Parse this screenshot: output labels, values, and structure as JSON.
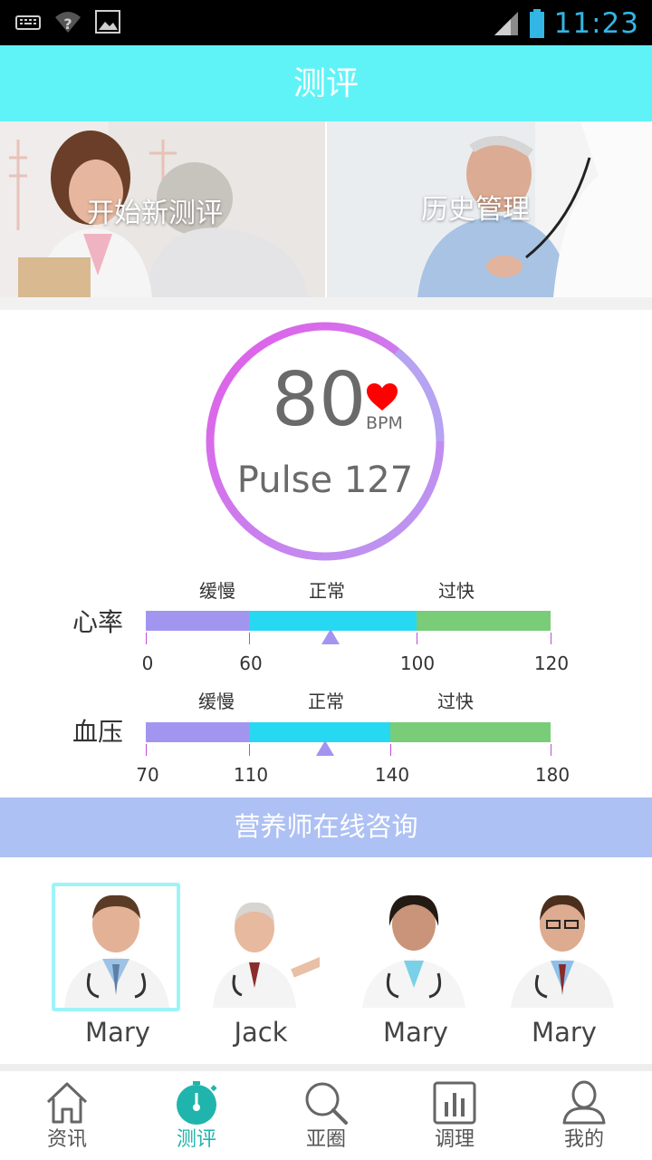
{
  "status_bar": {
    "time": "11:23",
    "icons": [
      "keyboard-icon",
      "wifi-unknown-icon",
      "image-icon",
      "signal-icon",
      "battery-icon"
    ],
    "time_color": "#33b5e5"
  },
  "header": {
    "title": "测评",
    "background": "#5ff3f7"
  },
  "banners": [
    {
      "label": "开始新测评"
    },
    {
      "label": "历史管理"
    }
  ],
  "gauge": {
    "value": "80",
    "unit": "BPM",
    "pulse_text": "Pulse 127",
    "heart_color": "#ff0000",
    "ring_colors": [
      "#e25ce8",
      "#b79cf2"
    ]
  },
  "meters": [
    {
      "name": "心率",
      "categories": [
        "缓慢",
        "正常",
        "过快"
      ],
      "ticks": [
        "0",
        "60",
        "100",
        "120"
      ],
      "pointer_value": 80,
      "colors": [
        "#a295f0",
        "#26d8f2",
        "#79cc78"
      ]
    },
    {
      "name": "血压",
      "categories": [
        "缓慢",
        "正常",
        "过快"
      ],
      "ticks": [
        "70",
        "110",
        "140",
        "180"
      ],
      "pointer_value": 122,
      "colors": [
        "#a295f0",
        "#26d8f2",
        "#79cc78"
      ]
    }
  ],
  "consult": {
    "title": "营养师在线咨询",
    "background": "#aec1f4",
    "experts": [
      {
        "name": "Mary",
        "selected": true
      },
      {
        "name": "Jack",
        "selected": false
      },
      {
        "name": "Mary",
        "selected": false
      },
      {
        "name": "Mary",
        "selected": false
      }
    ]
  },
  "bottom_nav": {
    "active_color": "#1fb5ac",
    "items": [
      {
        "label": "资讯",
        "icon": "home-icon",
        "active": false
      },
      {
        "label": "测评",
        "icon": "stopwatch-icon",
        "active": true
      },
      {
        "label": "亚圈",
        "icon": "search-icon",
        "active": false
      },
      {
        "label": "调理",
        "icon": "bar-chart-icon",
        "active": false
      },
      {
        "label": "我的",
        "icon": "user-icon",
        "active": false
      }
    ]
  }
}
